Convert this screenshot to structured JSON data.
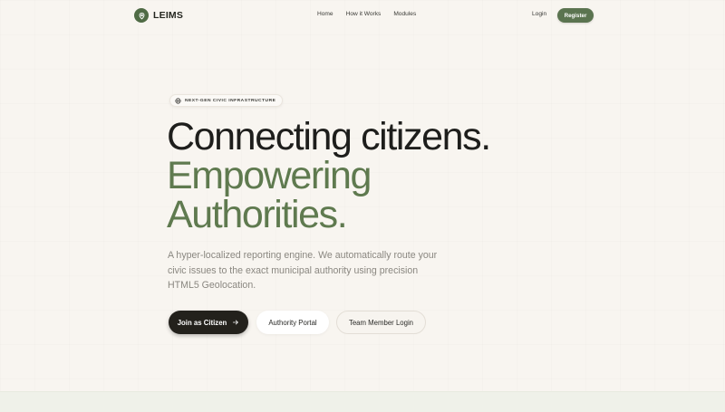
{
  "brand": {
    "name": "LEIMS",
    "logo_icon": "map-pin-icon",
    "accent_color": "#5b7450"
  },
  "nav": {
    "links": [
      {
        "label": "Home"
      },
      {
        "label": "How it Works"
      },
      {
        "label": "Modules"
      }
    ],
    "login_label": "Login",
    "register_label": "Register"
  },
  "hero": {
    "badge": {
      "icon": "globe-icon",
      "text": "NEXT-GEN CIVIC INFRASTRUCTURE"
    },
    "headline": {
      "line1": "Connecting citizens.",
      "line2": "Empowering",
      "line3": "Authorities."
    },
    "subtitle": "A hyper-localized reporting engine. We automatically route your civic issues to the exact municipal authority using precision HTML5 Geolocation.",
    "buttons": {
      "citizen": {
        "label": "Join as Citizen",
        "icon": "arrow-right-icon"
      },
      "authority": {
        "label": "Authority Portal"
      },
      "team": {
        "label": "Team Member Login"
      }
    }
  },
  "colors": {
    "background": "#f8f5f0",
    "headline_dark": "#1e1e1c",
    "headline_green": "#5f7a4f",
    "primary_button": "#23211c"
  }
}
